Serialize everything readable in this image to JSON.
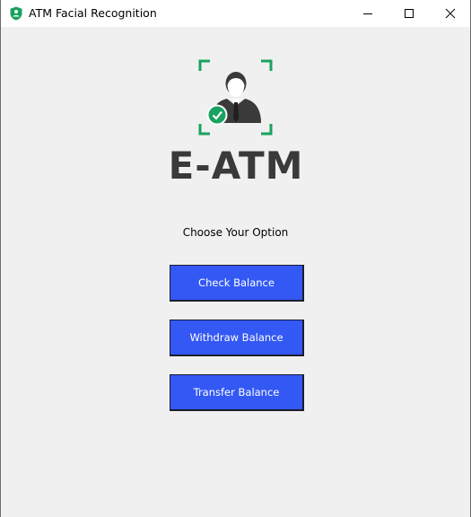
{
  "window": {
    "title": "ATM Facial Recognition"
  },
  "logo": {
    "wordmark": "E-ATM",
    "icon": "face-recognition-user-check-icon"
  },
  "main": {
    "prompt": "Choose Your Option",
    "buttons": [
      {
        "label": "Check Balance"
      },
      {
        "label": "Withdraw Balance"
      },
      {
        "label": "Transfer Balance"
      }
    ]
  },
  "colors": {
    "button_bg": "#3358f4",
    "accent_green": "#1aa260",
    "logo_gray": "#3a3a3a",
    "window_bg": "#f0f0f0"
  }
}
